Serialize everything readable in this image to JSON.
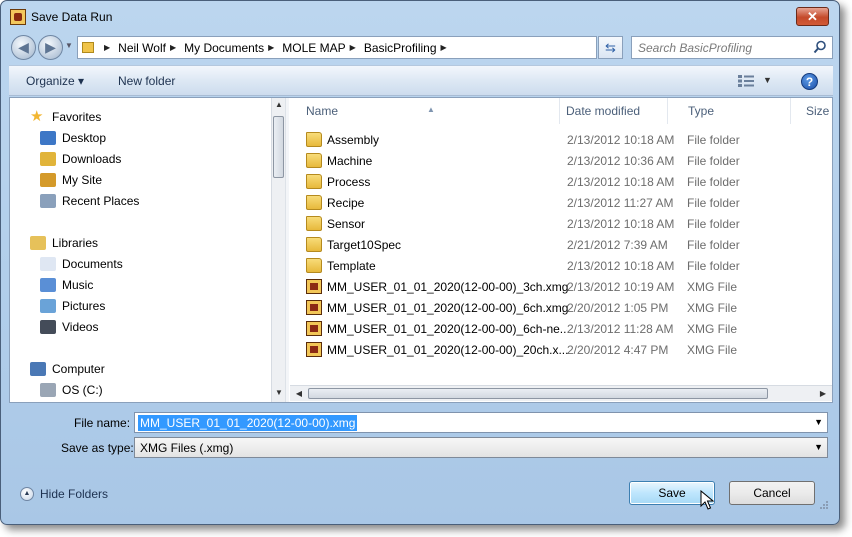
{
  "window": {
    "title": "Save Data Run",
    "close_glyph": "✕"
  },
  "nav": {
    "back_glyph": "◀",
    "forward_glyph": "▶",
    "breadcrumbs": [
      "Neil Wolf",
      "My Documents",
      "MOLE MAP",
      "BasicProfiling"
    ],
    "search_placeholder": "Search BasicProfiling"
  },
  "toolbar": {
    "organize_label": "Organize ▾",
    "new_folder_label": "New folder",
    "view_dd": "▼",
    "help_glyph": "?"
  },
  "sidebar": {
    "items": [
      {
        "label": "Favorites",
        "icon": "star-icon",
        "group": true
      },
      {
        "label": "Desktop",
        "icon": "desktop-icon",
        "group": false
      },
      {
        "label": "Downloads",
        "icon": "downloads-icon",
        "group": false
      },
      {
        "label": "My Site",
        "icon": "my-site-icon",
        "group": false
      },
      {
        "label": "Recent Places",
        "icon": "recent-places-icon",
        "group": false
      },
      {
        "label": "Libraries",
        "icon": "libraries-icon",
        "group": true
      },
      {
        "label": "Documents",
        "icon": "documents-icon",
        "group": false
      },
      {
        "label": "Music",
        "icon": "music-icon",
        "group": false
      },
      {
        "label": "Pictures",
        "icon": "pictures-icon",
        "group": false
      },
      {
        "label": "Videos",
        "icon": "videos-icon",
        "group": false
      },
      {
        "label": "Computer",
        "icon": "computer-icon",
        "group": true
      },
      {
        "label": "OS (C:)",
        "icon": "drive-icon",
        "group": false
      }
    ]
  },
  "columns": {
    "name": "Name",
    "date": "Date modified",
    "type": "Type",
    "size": "Size"
  },
  "files": [
    {
      "name": "Assembly",
      "date": "2/13/2012 10:18 AM",
      "type": "File folder",
      "kind": "folder"
    },
    {
      "name": "Machine",
      "date": "2/13/2012 10:36 AM",
      "type": "File folder",
      "kind": "folder"
    },
    {
      "name": "Process",
      "date": "2/13/2012 10:18 AM",
      "type": "File folder",
      "kind": "folder"
    },
    {
      "name": "Recipe",
      "date": "2/13/2012 11:27 AM",
      "type": "File folder",
      "kind": "folder"
    },
    {
      "name": "Sensor",
      "date": "2/13/2012 10:18 AM",
      "type": "File folder",
      "kind": "folder"
    },
    {
      "name": "Target10Spec",
      "date": "2/21/2012 7:39 AM",
      "type": "File folder",
      "kind": "folder"
    },
    {
      "name": "Template",
      "date": "2/13/2012 10:18 AM",
      "type": "File folder",
      "kind": "folder"
    },
    {
      "name": "MM_USER_01_01_2020(12-00-00)_3ch.xmg",
      "date": "2/13/2012 10:19 AM",
      "type": "XMG File",
      "kind": "xmg"
    },
    {
      "name": "MM_USER_01_01_2020(12-00-00)_6ch.xmg",
      "date": "2/20/2012 1:05 PM",
      "type": "XMG File",
      "kind": "xmg"
    },
    {
      "name": "MM_USER_01_01_2020(12-00-00)_6ch-ne...",
      "date": "2/13/2012 11:28 AM",
      "type": "XMG File",
      "kind": "xmg"
    },
    {
      "name": "MM_USER_01_01_2020(12-00-00)_20ch.x...",
      "date": "2/20/2012 4:47 PM",
      "type": "XMG File",
      "kind": "xmg"
    }
  ],
  "form": {
    "file_name_label": "File name:",
    "file_name_value": "MM_USER_01_01_2020(12-00-00).xmg",
    "save_as_type_label": "Save as type:",
    "save_as_type_value": "XMG Files (.xmg)",
    "dd_glyph": "▼"
  },
  "footer": {
    "hide_folders_label": "Hide Folders",
    "hide_glyph": "▲",
    "save_label": "Save",
    "cancel_label": "Cancel"
  }
}
